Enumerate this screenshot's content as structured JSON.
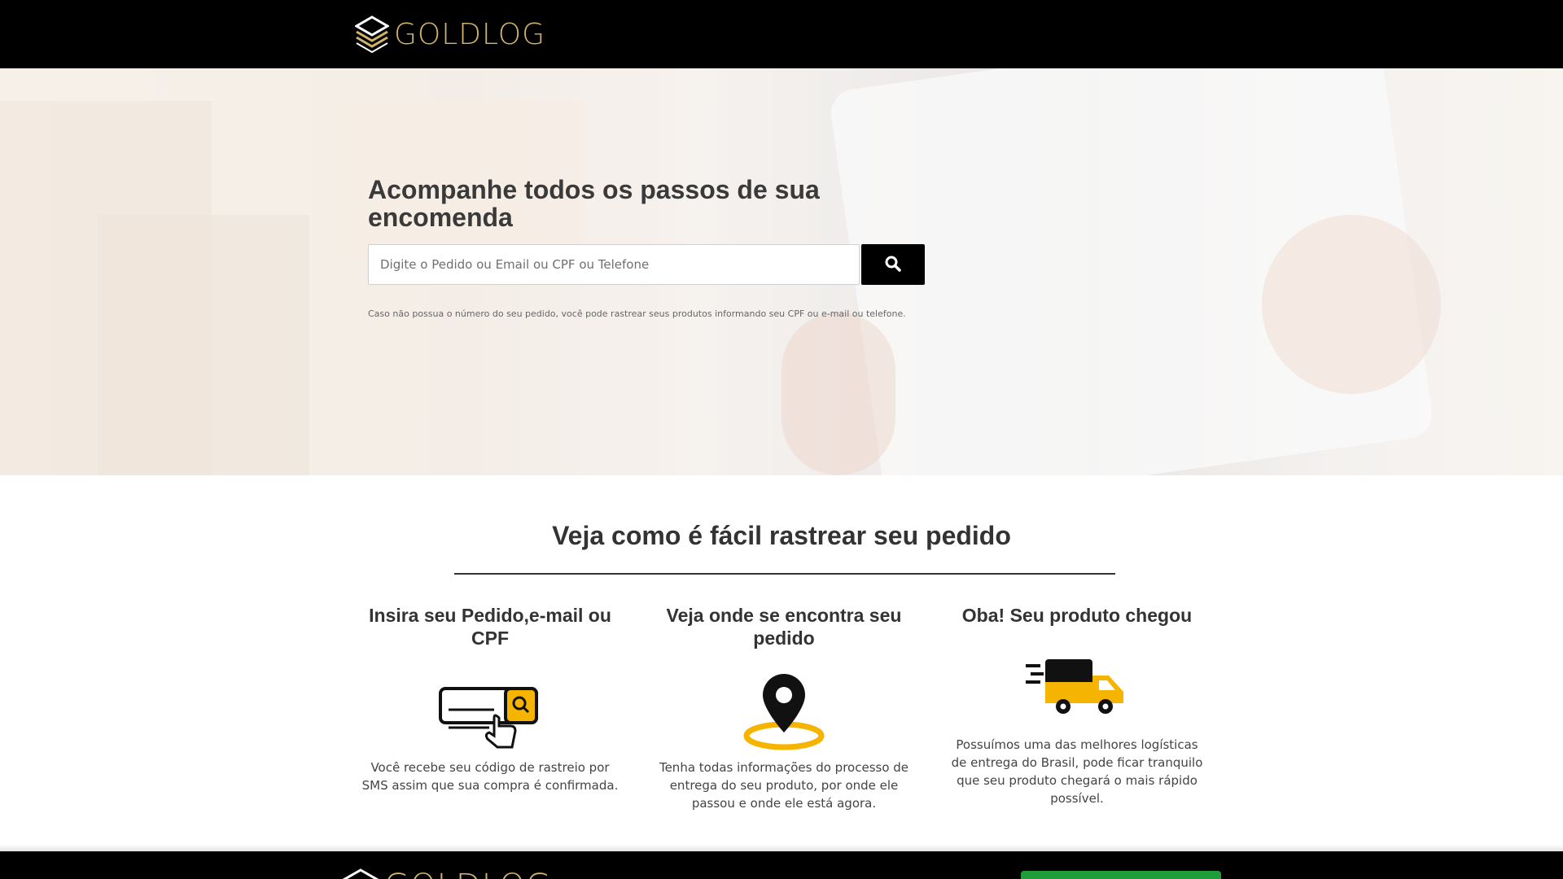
{
  "header": {
    "logo_text": "GOLDLOG",
    "logo_icon": "layered-diamond-icon"
  },
  "hero": {
    "title": "Acompanhe todos os passos de sua encomenda",
    "search": {
      "placeholder": "Digite o Pedido ou Email ou CPF ou Telefone",
      "value": "",
      "button_icon": "search-icon"
    },
    "hint": "Caso não possua o número do seu pedido, você pode rastrear seus produtos informando seu CPF ou e-mail ou telefone."
  },
  "how_it_works": {
    "title": "Veja como é fácil rastrear seu pedido",
    "steps": [
      {
        "title": "Insira seu Pedido,e-mail ou CPF",
        "icon": "search-bar-click-icon",
        "text": "Você recebe seu código de rastreio por SMS assim que sua compra é confirmada."
      },
      {
        "title": "Veja onde se encontra seu pedido",
        "icon": "location-pin-icon",
        "text": "Tenha todas informações do processo de entrega do seu produto, por onde ele passou e onde ele está agora."
      },
      {
        "title": "Oba! Seu produto chegou",
        "icon": "delivery-truck-icon",
        "text": "Possuímos uma das melhores logísticas de entrega do Brasil, pode ficar tranquilo que seu produto chegará o mais rápido possível."
      }
    ]
  },
  "footer": {
    "logo_text": "GOLDLOG",
    "whatsapp_icon": "whatsapp-icon"
  },
  "colors": {
    "header_bg": "#000000",
    "brand_gold": "#d2b46a",
    "accent_yellow": "#f4b400",
    "footer_button": "#1f9d3b"
  }
}
